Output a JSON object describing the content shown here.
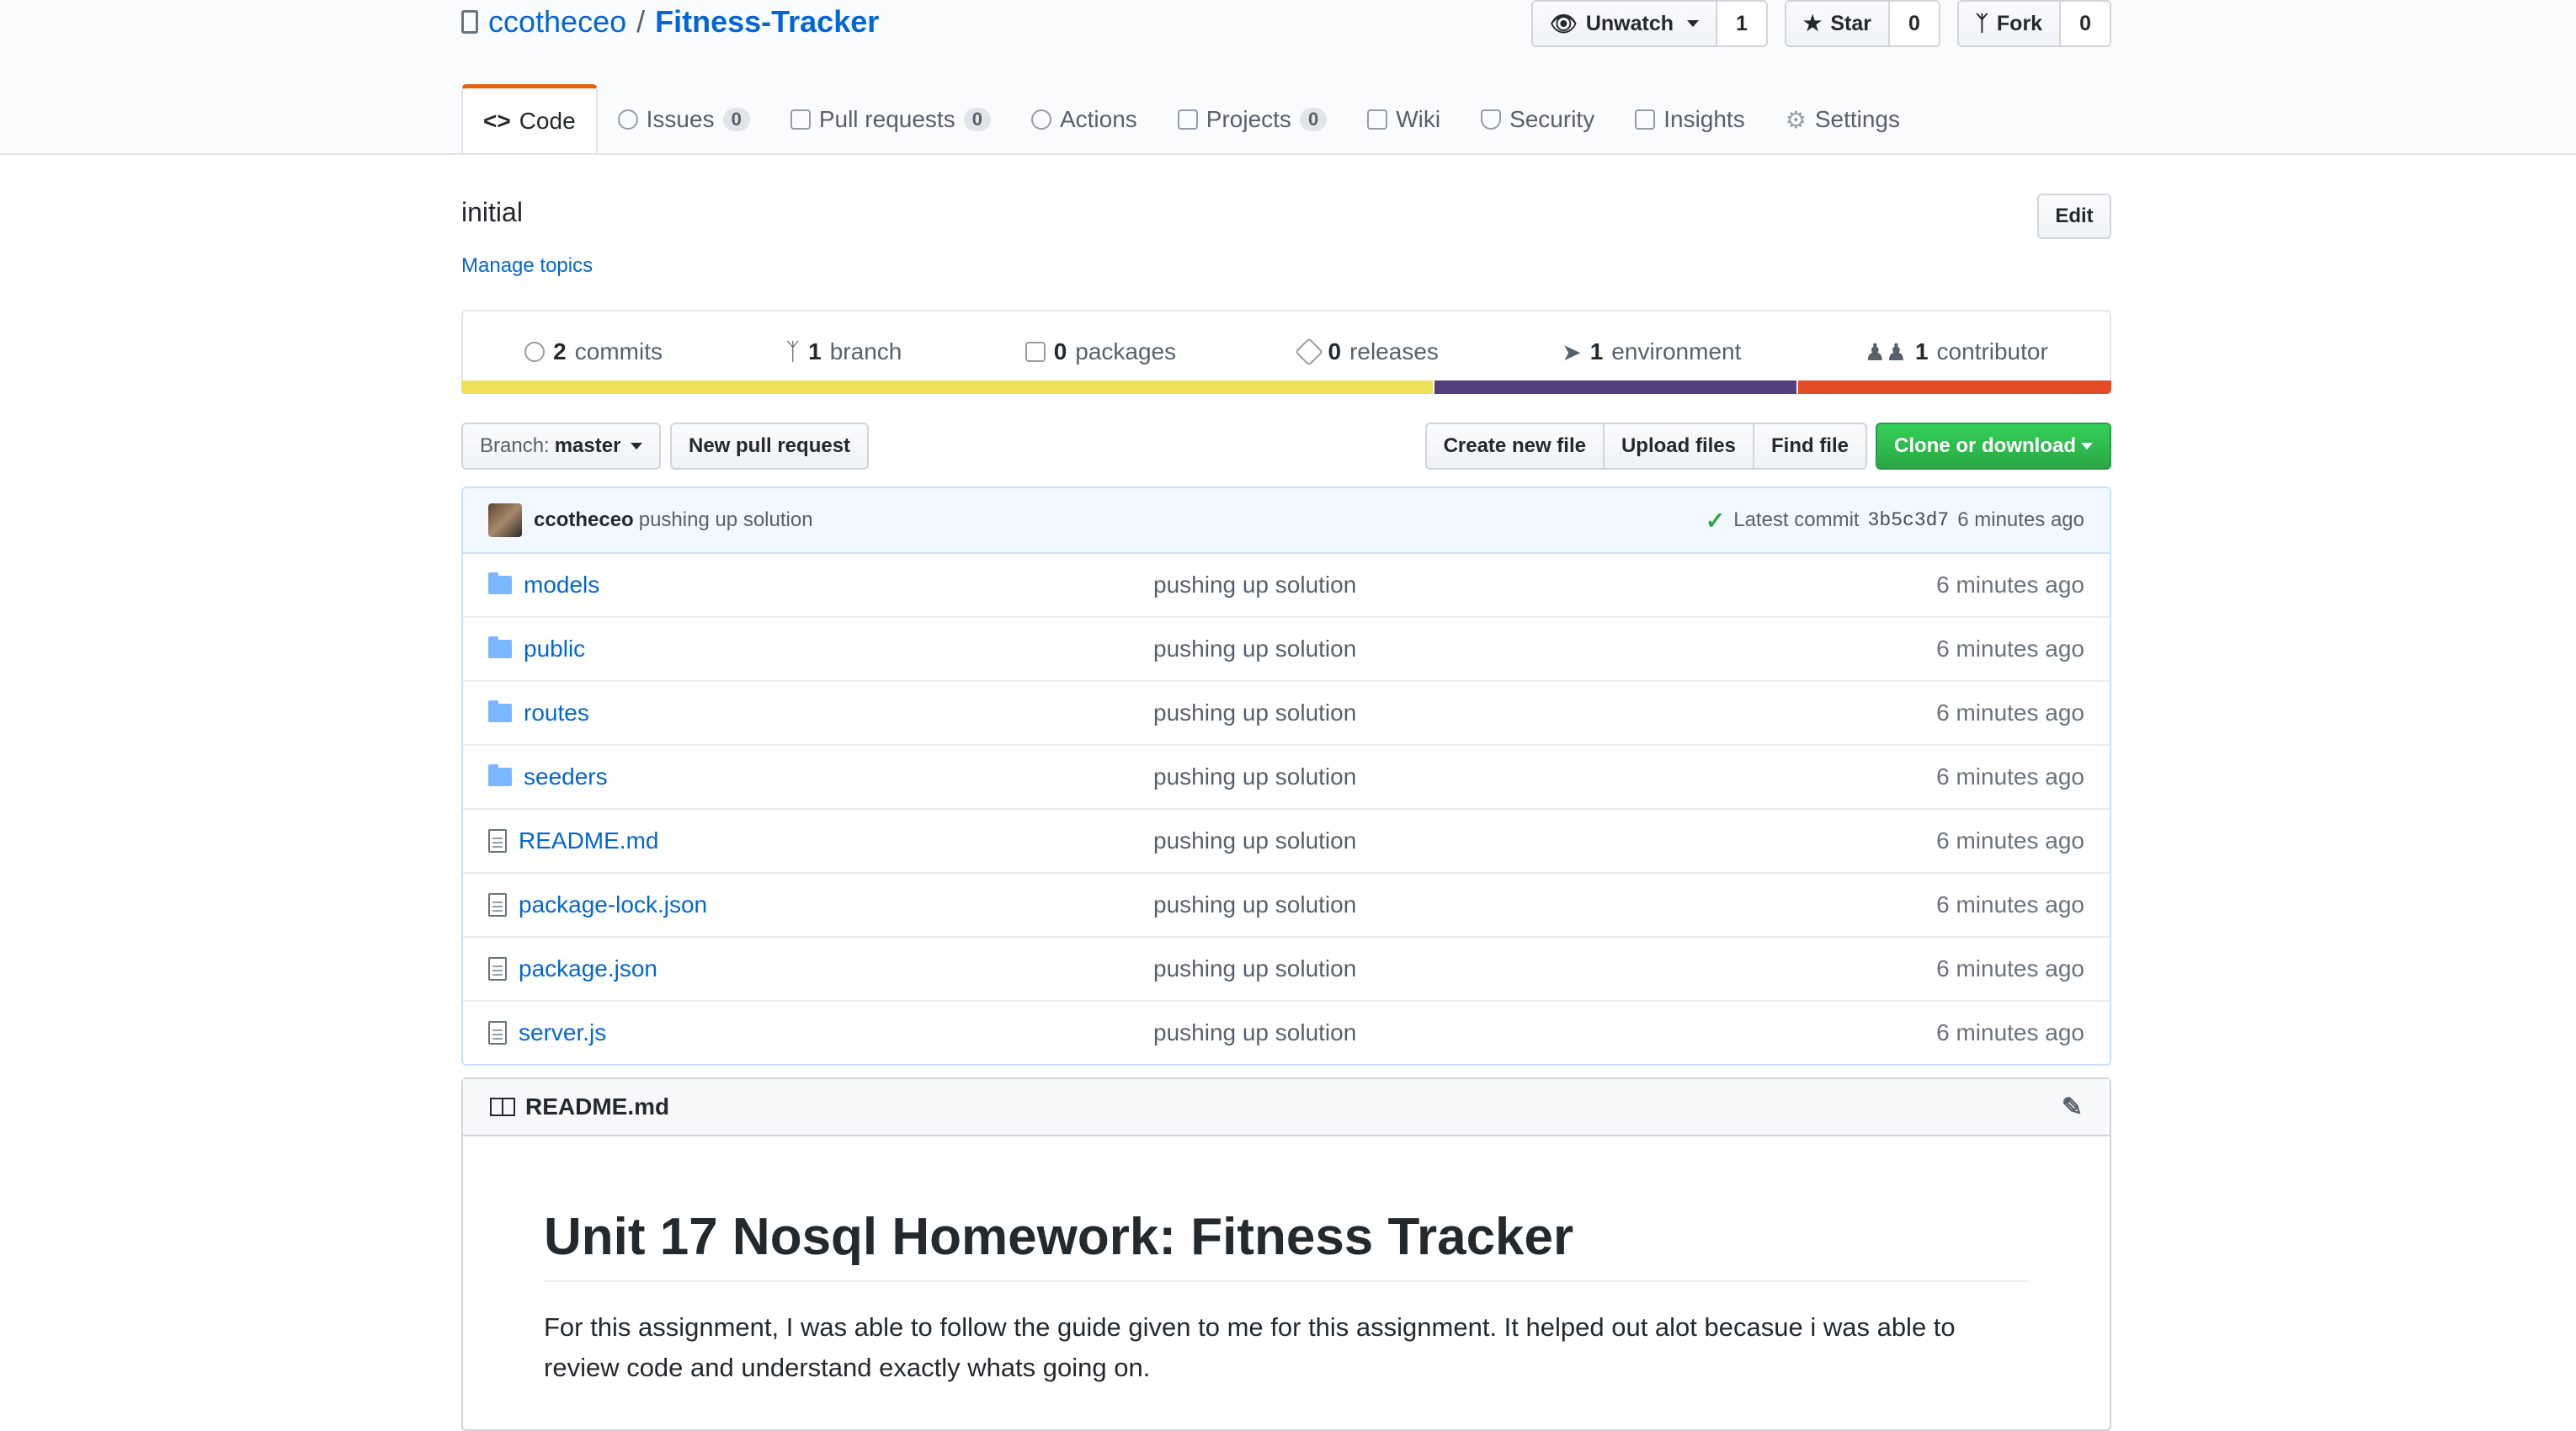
{
  "repo": {
    "owner": "ccotheceo",
    "separator": "/",
    "name": "Fitness-Tracker"
  },
  "actions": {
    "watch_label": "Unwatch",
    "watch_count": "1",
    "star_label": "Star",
    "star_count": "0",
    "fork_label": "Fork",
    "fork_count": "0"
  },
  "tabs": [
    {
      "label": "Code",
      "icon": "code-icon"
    },
    {
      "label": "Issues",
      "count": "0",
      "icon": "issue-icon"
    },
    {
      "label": "Pull requests",
      "count": "0",
      "icon": "pull-request-icon"
    },
    {
      "label": "Actions",
      "icon": "play-icon"
    },
    {
      "label": "Projects",
      "count": "0",
      "icon": "project-icon"
    },
    {
      "label": "Wiki",
      "icon": "book-icon"
    },
    {
      "label": "Security",
      "icon": "shield-icon"
    },
    {
      "label": "Insights",
      "icon": "graph-icon"
    },
    {
      "label": "Settings",
      "icon": "gear-icon"
    }
  ],
  "description": "initial",
  "manage_topics": "Manage topics",
  "edit_label": "Edit",
  "summary": [
    {
      "num": "2",
      "label": "commits",
      "icon": "history-icon"
    },
    {
      "num": "1",
      "label": "branch",
      "icon": "branch-icon"
    },
    {
      "num": "0",
      "label": "packages",
      "icon": "package-icon"
    },
    {
      "num": "0",
      "label": "releases",
      "icon": "tag-icon"
    },
    {
      "num": "1",
      "label": "environment",
      "icon": "rocket-icon"
    },
    {
      "num": "1",
      "label": "contributor",
      "icon": "people-icon"
    }
  ],
  "language_colors": [
    "#f1e05a",
    "#563d7c",
    "#e34c26"
  ],
  "language_shares": [
    0.59,
    0.22,
    0.19
  ],
  "file_nav": {
    "branch_prefix": "Branch:",
    "branch_name": "master",
    "new_pr": "New pull request",
    "create_file": "Create new file",
    "upload_files": "Upload files",
    "find_file": "Find file",
    "clone": "Clone or download"
  },
  "latest_commit": {
    "author": "ccotheceo",
    "message": "pushing up solution",
    "prefix": "Latest commit",
    "sha": "3b5c3d7",
    "age": "6 minutes ago"
  },
  "files": [
    {
      "name": "models",
      "type": "dir",
      "message": "pushing up solution",
      "age": "6 minutes ago"
    },
    {
      "name": "public",
      "type": "dir",
      "message": "pushing up solution",
      "age": "6 minutes ago"
    },
    {
      "name": "routes",
      "type": "dir",
      "message": "pushing up solution",
      "age": "6 minutes ago"
    },
    {
      "name": "seeders",
      "type": "dir",
      "message": "pushing up solution",
      "age": "6 minutes ago"
    },
    {
      "name": "README.md",
      "type": "file",
      "message": "pushing up solution",
      "age": "6 minutes ago"
    },
    {
      "name": "package-lock.json",
      "type": "file",
      "message": "pushing up solution",
      "age": "6 minutes ago"
    },
    {
      "name": "package.json",
      "type": "file",
      "message": "pushing up solution",
      "age": "6 minutes ago"
    },
    {
      "name": "server.js",
      "type": "file",
      "message": "pushing up solution",
      "age": "6 minutes ago"
    }
  ],
  "readme": {
    "filename": "README.md",
    "heading": "Unit 17 Nosql Homework: Fitness Tracker",
    "paragraph": "For this assignment, I was able to follow the guide given to me for this assignment. It helped out alot becasue i was able to review code and understand exactly whats going on."
  }
}
